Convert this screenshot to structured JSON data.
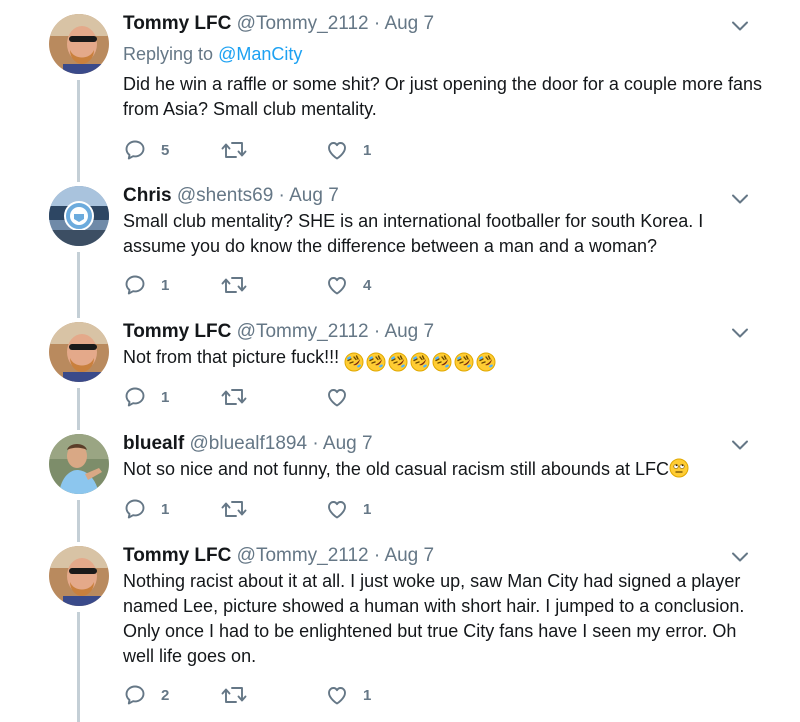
{
  "tweets": [
    {
      "name": "Tommy LFC",
      "handle": "@Tommy_2112",
      "dot": "·",
      "date": "Aug 7",
      "replying_prefix": "Replying to ",
      "replying_to": "@ManCity",
      "text": "Did he win a raffle or some shit? Or just opening the door for a couple more fans from Asia? Small club mentality.",
      "reply_count": "5",
      "retweet_count": "",
      "like_count": "1",
      "avatar": "tommy"
    },
    {
      "name": "Chris",
      "handle": "@shents69",
      "dot": "·",
      "date": "Aug 7",
      "text": "Small club mentality? SHE is an international footballer for south Korea. I assume you do know the difference between a man and a woman?",
      "reply_count": "1",
      "retweet_count": "",
      "like_count": "4",
      "avatar": "mancity"
    },
    {
      "name": "Tommy LFC",
      "handle": "@Tommy_2112",
      "dot": "·",
      "date": "Aug 7",
      "text": "Not from that picture fuck!!! ",
      "emoji": "rolling-on-floor-laughing",
      "emoji_count": 7,
      "reply_count": "1",
      "retweet_count": "",
      "like_count": "",
      "avatar": "tommy"
    },
    {
      "name": "bluealf",
      "handle": "@bluealf1894",
      "dot": "·",
      "date": "Aug 7",
      "text": "Not so nice and not funny, the old casual racism still abounds at LFC",
      "emoji": "face-with-rolling-eyes",
      "reply_count": "1",
      "retweet_count": "",
      "like_count": "1",
      "avatar": "bluealf"
    },
    {
      "name": "Tommy LFC",
      "handle": "@Tommy_2112",
      "dot": "·",
      "date": "Aug 7",
      "text": "Nothing racist about it at all. I just woke up, saw Man City had signed a player named Lee, picture showed a human with short hair. I jumped to a conclusion. Only once I had to be enlightened but true City fans have I seen my error. Oh well life goes on.",
      "reply_count": "2",
      "retweet_count": "",
      "like_count": "1",
      "avatar": "tommy"
    }
  ],
  "icons": {
    "reply": "reply-icon",
    "retweet": "retweet-icon",
    "like": "heart-icon",
    "caret": "chevron-down-icon"
  },
  "colors": {
    "text": "#14171a",
    "muted": "#657786",
    "link": "#1da1f2",
    "thread_line": "#c4cfd6"
  }
}
